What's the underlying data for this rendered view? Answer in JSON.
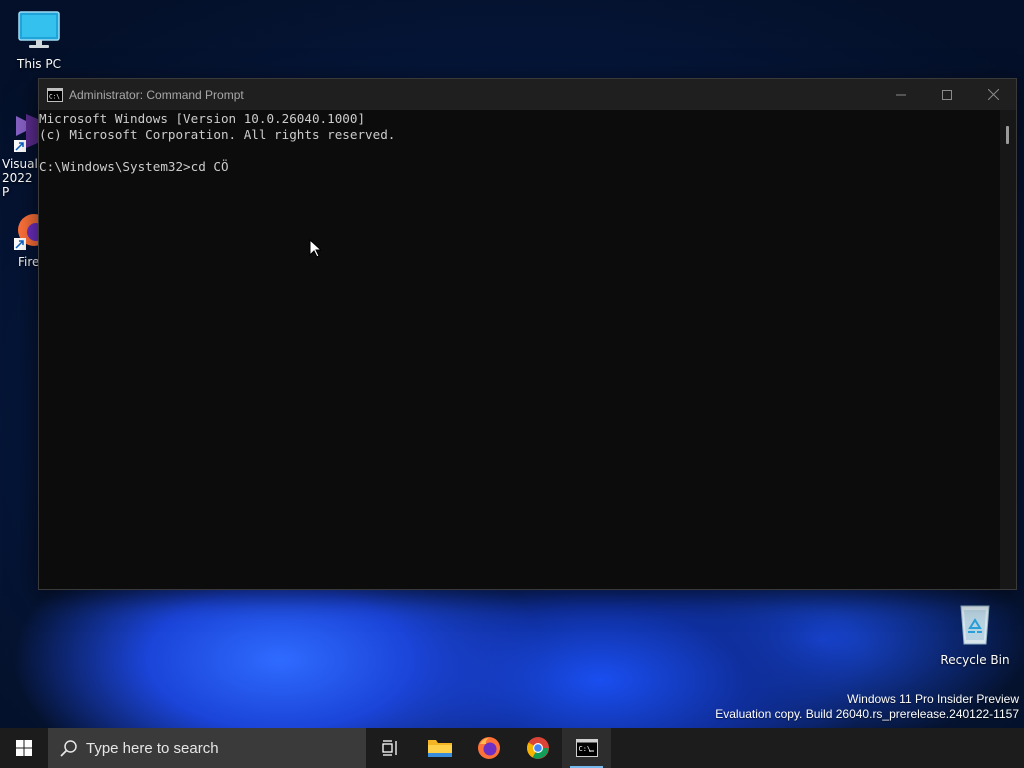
{
  "desktop": {
    "icons": [
      {
        "label": "This PC"
      },
      {
        "label": "Visual 2022 P"
      },
      {
        "label": "Fire"
      },
      {
        "label": "Recycle Bin"
      }
    ],
    "watermark": {
      "line1": "Windows 11 Pro Insider Preview",
      "line2": "Evaluation copy. Build 26040.rs_prerelease.240122-1157"
    }
  },
  "window": {
    "title": "Administrator: Command Prompt",
    "controls": [
      "minimize",
      "maximize",
      "close"
    ]
  },
  "console": {
    "lines": [
      "Microsoft Windows [Version 10.0.26040.1000]",
      "(c) Microsoft Corporation. All rights reserved.",
      "",
      "C:\\Windows\\System32>cd CÖ"
    ]
  },
  "taskbar": {
    "search_placeholder": "Type here to search",
    "apps": [
      "task-view",
      "file-explorer",
      "firefox",
      "chrome",
      "command-prompt"
    ],
    "active_app": "command-prompt"
  },
  "colors": {
    "console_bg": "#0c0c0c",
    "console_text": "#cccccc",
    "taskbar_bg": "#1c1c1c",
    "accent": "#76b9ed"
  }
}
